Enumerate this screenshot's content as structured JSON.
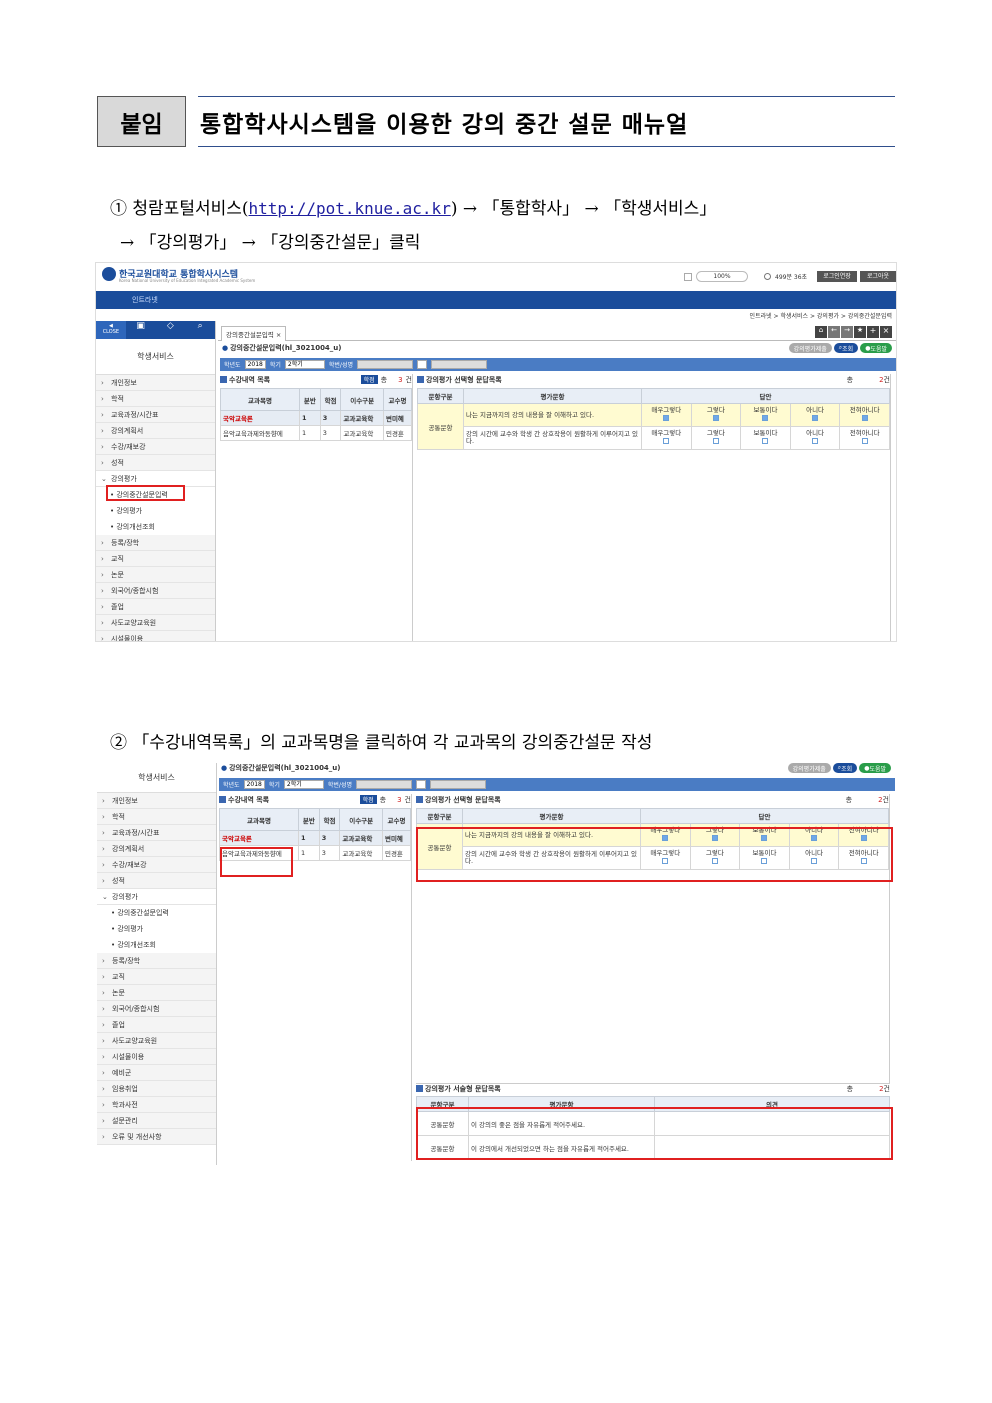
{
  "header": {
    "label": "붙임",
    "title": "통합학사시스템을 이용한 강의 중간 설문 매뉴얼"
  },
  "step1": {
    "num": "①",
    "part1": "청람포털서비스(",
    "url": "http://pot.knue.ac.kr",
    "part2": ")  →  「통합학사」  →  「학생서비스」",
    "line2": "→  「강의평가」  →  「강의중간설문」클릭"
  },
  "step2": {
    "text": "②  「수강내역목록」의 교과목명을 클릭하여 각 교과목의 강의중간설문 작성"
  },
  "app": {
    "logo_name": "한국교원대학교 통합학사시스템",
    "logo_sub": "Korea National University of Education Integrated Academic System",
    "zoom": "100%",
    "session": "499분 36초",
    "btn_login_ext": "로그인연장",
    "btn_logout": "로그아웃",
    "nav_label": "인트라넷",
    "breadcrumb": "인트라넷 > 학생서비스 > 강의평가 > 강의중간설문입력",
    "tab_label": "강의중간설문입력",
    "page_heading": "강의중간설문입력(hl_3021004_u)",
    "sidebar_title": "학생서비스",
    "close_label": "CLOSE",
    "filter": {
      "year_label": "학년도",
      "year": "2018",
      "term_label": "학기",
      "term": "2학기",
      "id_label": "학번/성명"
    },
    "btn_print": "강의평가제출",
    "btn_search": "조회",
    "btn_help": "도움말",
    "list_title": "수강내역 목록",
    "list_btn": "학점",
    "total_label": "총",
    "list_count": "3",
    "count_unit": "건",
    "eval_title": "강의평가 선택형 문답목록",
    "eval_count": "2",
    "essay_title": "강의평가 서술형 문답목록",
    "essay_count": "2"
  },
  "menu1": [
    "개인정보",
    "학적",
    "교육과정/시간표",
    "강의계획서",
    "수강/재보강",
    "성적"
  ],
  "menu_eval": "강의평가",
  "menu_eval_sub": [
    "강의중간설문입력",
    "강의평가",
    "강의개선조회"
  ],
  "menu2": [
    "등록/장학",
    "교직",
    "논문",
    "외국어/종합시험",
    "졸업",
    "사도교양교육원",
    "시설물이용"
  ],
  "menu3_extra": [
    "예비군",
    "임용취업",
    "학과사전",
    "설문관리",
    "오류 및 개선사항"
  ],
  "course_table": {
    "headers": [
      "교과목명",
      "분반",
      "학점",
      "이수구분",
      "교수명"
    ],
    "rows": [
      [
        "국악교육론",
        "1",
        "3",
        "교과교육학",
        "변미혜"
      ],
      [
        "음악교육과제와동향에",
        "1",
        "3",
        "교과교육학",
        "민경훈"
      ]
    ]
  },
  "eval_table": {
    "headers": [
      "문항구분",
      "평가문항",
      "답안"
    ],
    "category": "공통문항",
    "options": [
      "매우그렇다",
      "그렇다",
      "보통이다",
      "아니다",
      "전혀아니다"
    ],
    "questions": [
      "나는 지금까지의 강의 내용을 잘 이해하고 있다.",
      "강의 시간에 교수와 학생 간 상호작용이 원활하게 이루어지고 있다."
    ]
  },
  "essay_table": {
    "headers": [
      "문항구분",
      "평가문항",
      "의견"
    ],
    "rows": [
      [
        "공통문항",
        "이 강의의 좋은 점을 자유롭게 적어주세요."
      ],
      [
        "공통문항",
        "이 강의에서 개선되었으면 하는 점을 자유롭게 적어주세요."
      ]
    ]
  }
}
